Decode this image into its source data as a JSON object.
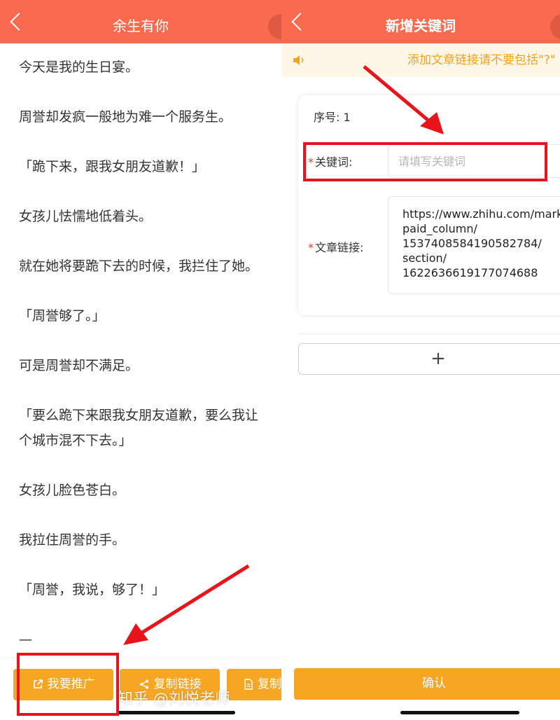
{
  "left_screen": {
    "title": "余生有你",
    "paragraphs": [
      "今天是我的生日宴。",
      "周誉却发疯一般地为难一个服务生。",
      "「跪下来，跟我女朋友道歉！」",
      "女孩儿怯懦地低着头。",
      "就在她将要跪下去的时候，我拦住了她。",
      "「周誉够了。」",
      "可是周誉却不满足。",
      "「要么跪下来跟我女朋友道歉，要么我让\n个城市混不下去。」",
      "女孩儿脸色苍白。",
      "我拉住周誉的手。",
      "「周誉，我说，够了！」",
      "—"
    ],
    "buttons": {
      "promote": "我要推广",
      "copy_link": "复制链接",
      "copy_other": "复制"
    }
  },
  "right_screen": {
    "title": "新增关键词",
    "notice": "添加文章链接请不要包括\"?\"",
    "serial_label": "序号: 1",
    "keyword_label": "关键词:",
    "keyword_placeholder": "请填写关键词",
    "link_label": "文章链接:",
    "link_lines": [
      "https://www.zhihu.com/mark",
      "paid_column/",
      "1537408584190582784/",
      "section/",
      "1622636619177074688"
    ],
    "add_symbol": "+",
    "confirm": "确认"
  },
  "watermark": "知乎 @刘悦老师",
  "colors": {
    "header": "#fa6a4e",
    "button": "#f6a623",
    "notice_text": "#f5a31a",
    "annotation": "#e8141c"
  }
}
